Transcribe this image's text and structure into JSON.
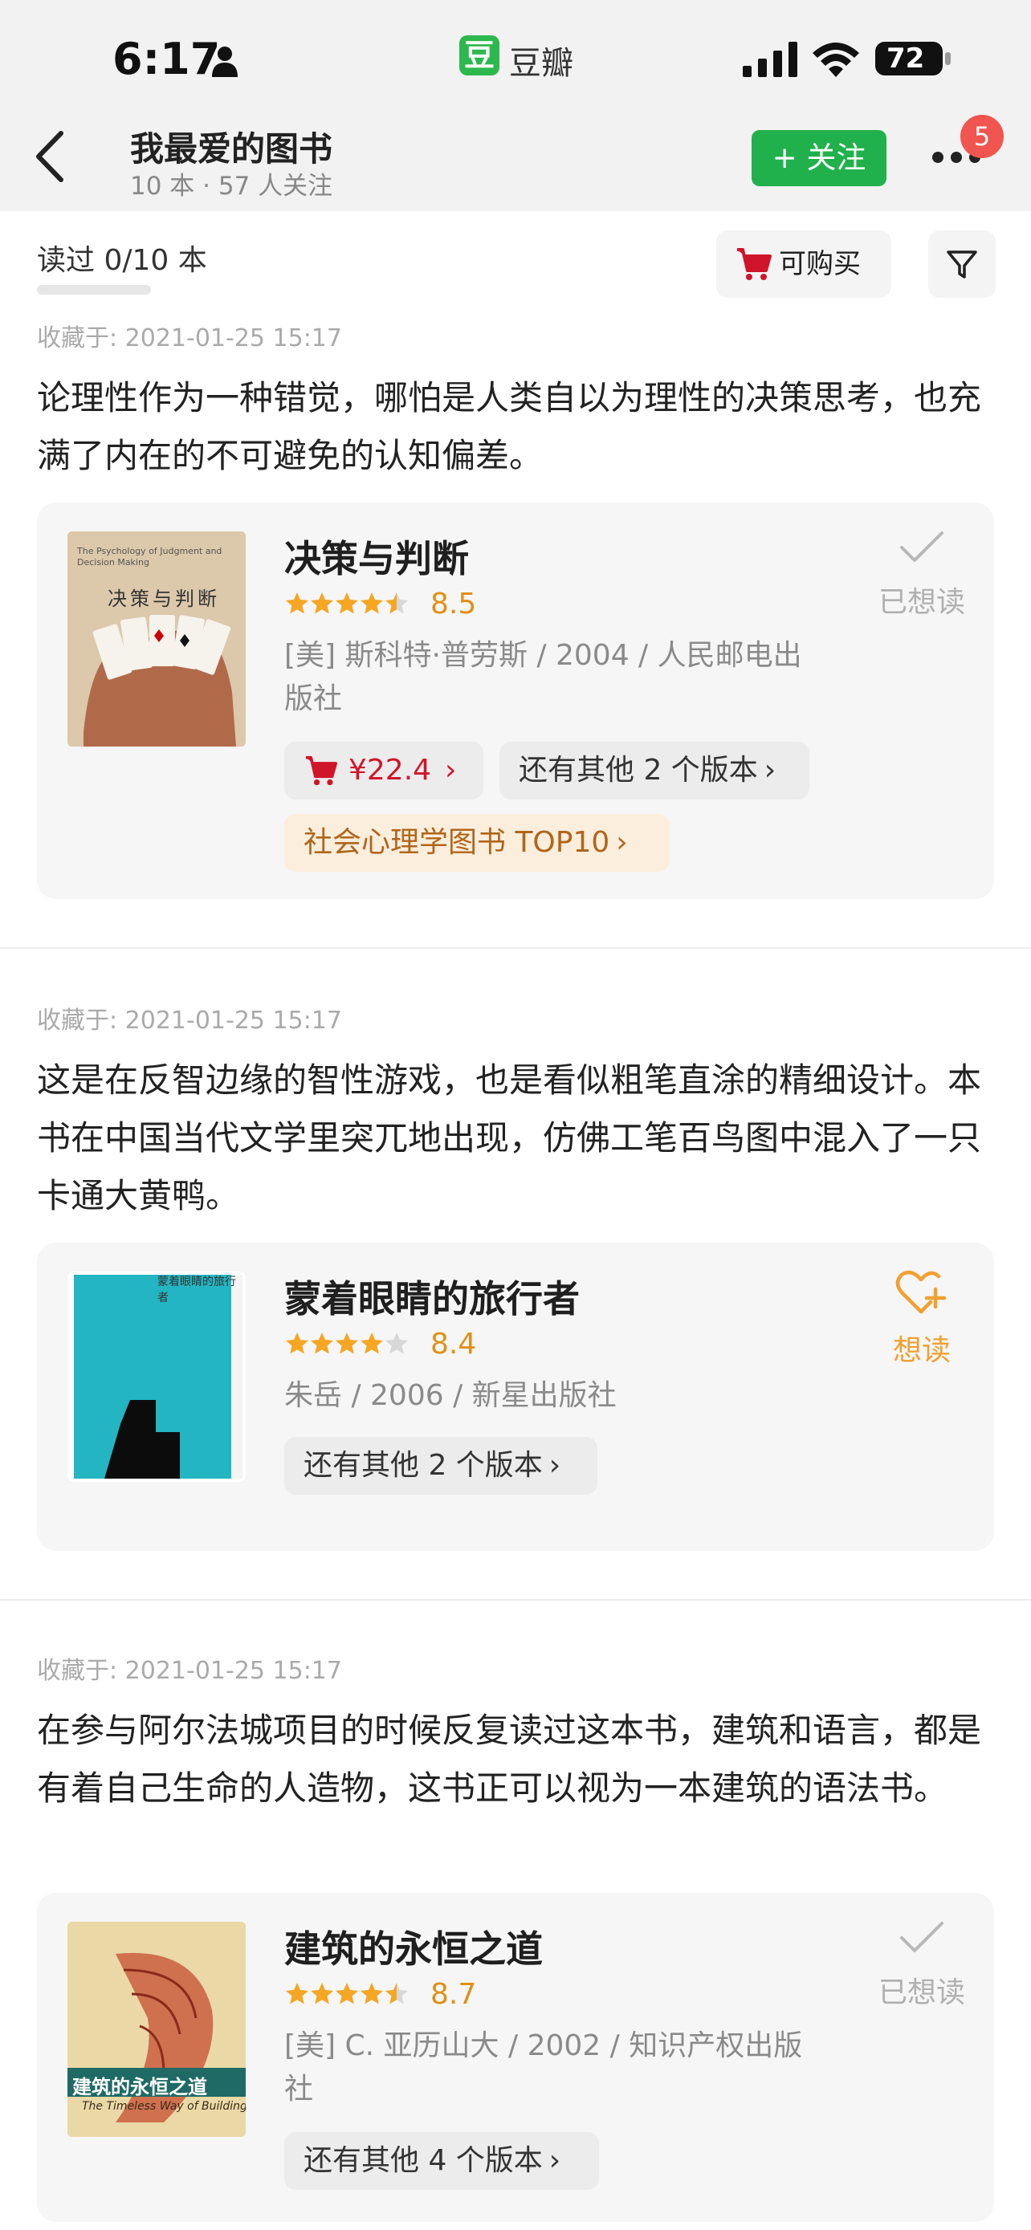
{
  "status_bar": {
    "time": "6:17",
    "app_name": "豆瓣",
    "app_badge_char": "豆",
    "battery": "72"
  },
  "header": {
    "title": "我最爱的图书",
    "subtitle": "10 本 · 57 人关注",
    "follow_label": "+ 关注",
    "notification_count": "5"
  },
  "filters": {
    "read_count": "读过 0/10 本",
    "read_progress": 0.0,
    "buy_label": "可购买"
  },
  "entries": [
    {
      "date": "收藏于: 2021-01-25 15:17",
      "comment": "论理性作为一种错觉，哪怕是人类自以为理性的决策思考，也充满了内在的不可避免的认知偏差。",
      "book": {
        "title": "决策与判断",
        "rating": "8.5",
        "stars": 4.5,
        "meta": "[美] 斯科特·普劳斯 / 2004 / 人民邮电出版社",
        "price": "¥22.4",
        "versions": "还有其他 2 个版本",
        "rank": "社会心理学图书 TOP10",
        "status": "已想读",
        "cover_title": "决策与判断",
        "cover_en": "The Psychology of Judgment and Decision Making"
      }
    },
    {
      "date": "收藏于: 2021-01-25 15:17",
      "comment": "这是在反智边缘的智性游戏，也是看似粗笔直涂的精细设计。本书在中国当代文学里突兀地出现，仿佛工笔百鸟图中混入了一只卡通大黄鸭。",
      "book": {
        "title": "蒙着眼睛的旅行者",
        "rating": "8.4",
        "stars": 4.0,
        "meta": "朱岳 / 2006 / 新星出版社",
        "versions": "还有其他 2 个版本",
        "status": "想读",
        "cover_title": "蒙着眼睛的旅行者"
      }
    },
    {
      "date": "收藏于: 2021-01-25 15:17",
      "comment": "在参与阿尔法城项目的时候反复读过这本书，建筑和语言，都是有着自己生命的人造物，这书正可以视为一本建筑的语法书。",
      "book": {
        "title": "建筑的永恒之道",
        "rating": "8.7",
        "stars": 4.5,
        "meta": "[美] C. 亚历山大 / 2002 / 知识产权出版社",
        "versions": "还有其他 4 个版本",
        "status": "已想读",
        "cover_title": "建筑的永恒之道",
        "cover_en": "The Timeless Way of Building"
      }
    }
  ],
  "colors": {
    "follow_green": "#21b14c",
    "rating_orange": "#e09015",
    "price_red": "#d0152a",
    "badge_red": "#f0554f",
    "want_orange": "#f0a030"
  }
}
